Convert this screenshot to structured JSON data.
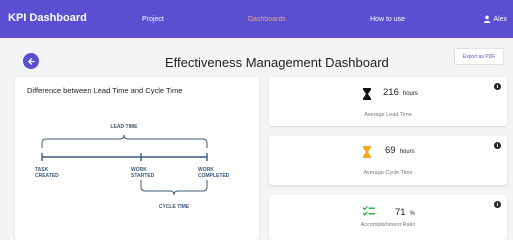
{
  "navbar": {
    "brand": "KPI Dashboard",
    "links": [
      {
        "label": "Project",
        "active": false
      },
      {
        "label": "Dashboards",
        "active": true
      },
      {
        "label": "How to use",
        "active": false
      }
    ],
    "user": "Alex"
  },
  "header": {
    "title": "Effectiveness Management Dashboard",
    "export_label": "Export as PDF"
  },
  "diagram": {
    "title": "Difference between Lead Time and Cycle Time",
    "lead_time_label": "LEAD TIME",
    "cycle_time_label": "CYCLE TIME",
    "points": [
      {
        "line1": "TASK",
        "line2": "CREATED"
      },
      {
        "line1": "WORK",
        "line2": "STARTED"
      },
      {
        "line1": "WORK",
        "line2": "COMPLETED"
      }
    ]
  },
  "kpis": [
    {
      "value": "216",
      "unit": "hours",
      "caption": "Average Lead Time",
      "icon": "hourglass-icon",
      "color": "#111111"
    },
    {
      "value": "69",
      "unit": "hours",
      "caption": "Average Cycle Time",
      "icon": "hourglass-icon",
      "color": "#f5a623"
    },
    {
      "value": "71",
      "unit": "%",
      "caption": "Accomplishment Ratio",
      "icon": "checklist-icon",
      "color": "#2eaa3a"
    }
  ],
  "colors": {
    "primary": "#5a4fd0",
    "active_link": "#f3a37c",
    "diagram_line": "#3b5a78"
  }
}
